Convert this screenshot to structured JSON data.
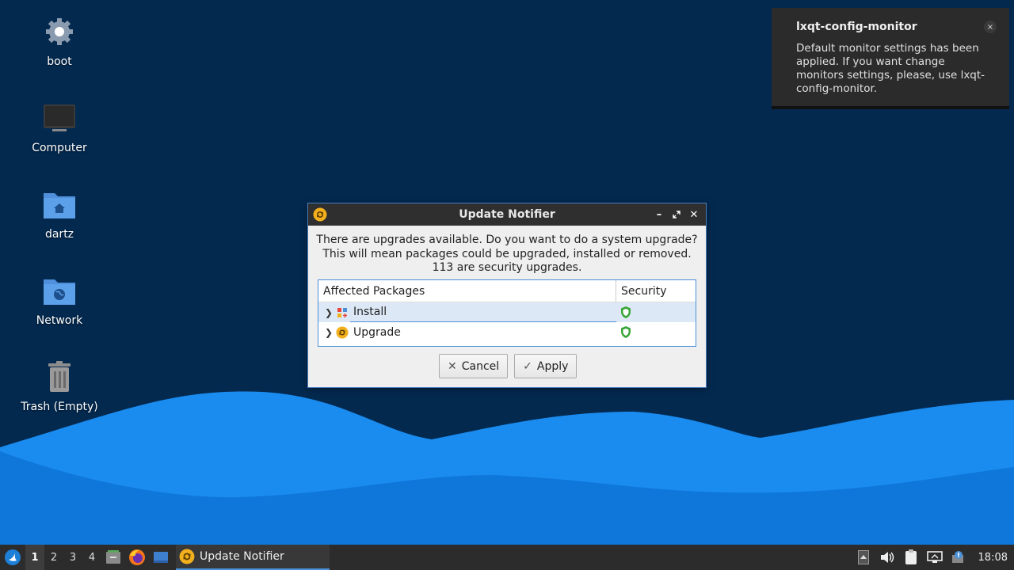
{
  "desktop": {
    "icons": [
      {
        "label": "boot",
        "icon": "gear-icon"
      },
      {
        "label": "Computer",
        "icon": "monitor-icon"
      },
      {
        "label": "dartz",
        "icon": "home-folder-icon"
      },
      {
        "label": "Network",
        "icon": "network-folder-icon"
      },
      {
        "label": "Trash (Empty)",
        "icon": "trash-icon"
      }
    ]
  },
  "notification": {
    "title": "lxqt-config-monitor",
    "body": "Default monitor settings has been applied. If you want change monitors settings, please, use lxqt-config-monitor.",
    "close_glyph": "×"
  },
  "dialog": {
    "title": "Update Notifier",
    "message_lines": [
      "There are upgrades available. Do you want to do a system upgrade?",
      "This will mean packages could be upgraded, installed or removed.",
      "113 are security upgrades."
    ],
    "tree": {
      "columns": [
        "Affected Packages",
        "Security"
      ],
      "rows": [
        {
          "label": "Install",
          "icon": "install-icon",
          "security_icon": "shield-icon"
        },
        {
          "label": "Upgrade",
          "icon": "upgrade-icon",
          "security_icon": "shield-icon"
        }
      ]
    },
    "cancel_label": "Cancel",
    "apply_label": "Apply"
  },
  "taskbar": {
    "desktops": [
      "1",
      "2",
      "3",
      "4"
    ],
    "task_label": "Update Notifier",
    "clock": "18:08"
  },
  "colors": {
    "wallpaper_dark": "#03294f",
    "wave_light": "#1a8cf0",
    "accent": "#4a90d9",
    "shield_green": "#3aa63a"
  }
}
